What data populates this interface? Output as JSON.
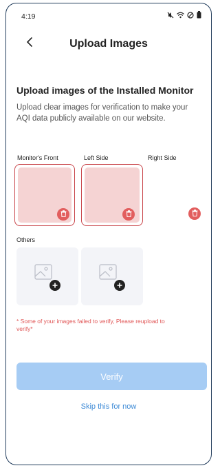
{
  "status_bar": {
    "time": "4:19",
    "icons": [
      "mute-icon",
      "wifi-icon",
      "do-not-disturb-icon",
      "battery-icon"
    ]
  },
  "header": {
    "back_icon": "chevron-left-icon",
    "title": "Upload Images"
  },
  "section": {
    "title": "Upload images of the Installed Monitor",
    "description": "Upload clear images for verification to make your AQI data publicly available on our website."
  },
  "slots": [
    {
      "label": "Monitor's Front",
      "state": "failed"
    },
    {
      "label": "Left Side",
      "state": "failed"
    },
    {
      "label": "Right Side",
      "state": "failed"
    }
  ],
  "others": {
    "label": "Others",
    "tiles": 2,
    "icon": "image-add-icon"
  },
  "error": "* Some of your images failed to verify, Please reupload to verify*",
  "actions": {
    "verify_label": "Verify",
    "skip_label": "Skip this for now"
  },
  "colors": {
    "accent": "#3d8ad6",
    "verify_disabled": "#a6ccf4",
    "error": "#e05555",
    "failed_fill": "#f5d3d3",
    "failed_border": "#c9454a",
    "delete": "#e25e5e"
  }
}
